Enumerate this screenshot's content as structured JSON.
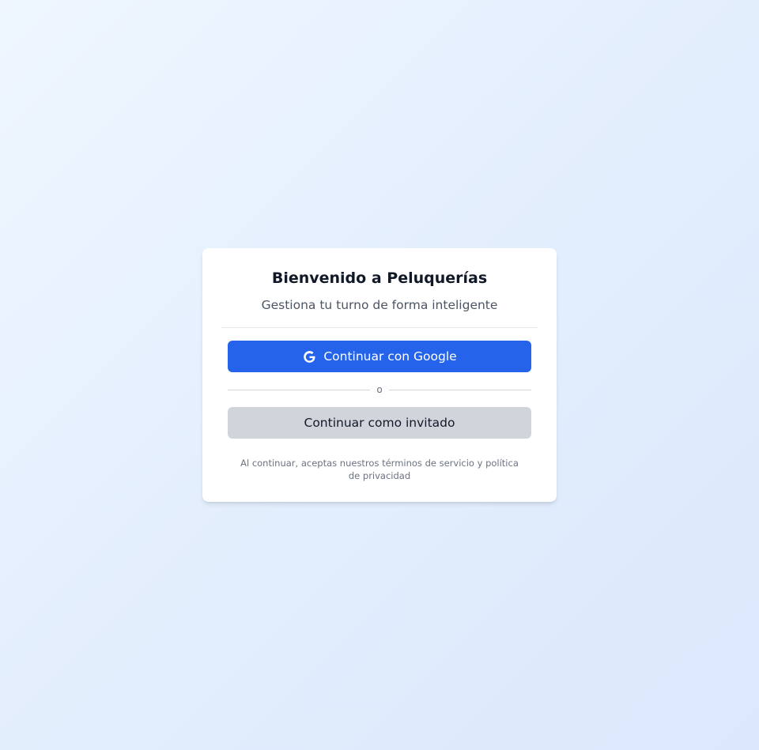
{
  "login": {
    "title": "Bienvenido a Peluquerías",
    "subtitle": "Gestiona tu turno de forma inteligente",
    "google_button": {
      "label": "Continuar con Google",
      "icon": "google-g-icon"
    },
    "divider_text": "o",
    "guest_button": {
      "label": "Continuar como invitado"
    },
    "legal_text": "Al continuar, aceptas nuestros términos de servicio y política de privacidad"
  },
  "colors": {
    "primary": "#2563eb",
    "secondary": "#d1d5db",
    "background_start": "#eff6ff",
    "background_end": "#dbe8fc"
  }
}
